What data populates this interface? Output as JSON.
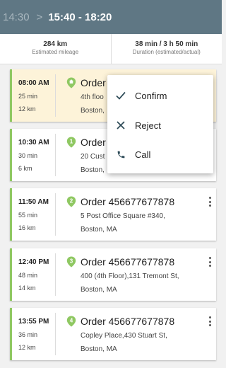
{
  "header": {
    "prev_range": "14:30",
    "separator": ">",
    "current_range": "15:40 - 18:20"
  },
  "stats": {
    "mileage_value": "284 km",
    "mileage_label": "Estimated mileage",
    "duration_value": "38 min / 3 h 50 min",
    "duration_label": "Duration (estimated/actual)"
  },
  "colors": {
    "header_bg": "#5f7784",
    "accent_green": "#8fc862",
    "selected_bg": "#fdf3d9"
  },
  "orders": [
    {
      "time": "08:00 AM",
      "duration": "25 min",
      "distance": "12 km",
      "title": "Order '",
      "addr1": "4th floo",
      "addr2": "Boston,",
      "number": "",
      "icon": "home-pin-icon"
    },
    {
      "time": "10:30 AM",
      "duration": "30 min",
      "distance": "6 km",
      "title": "Order 4",
      "addr1": "20 Cust",
      "addr2": "Boston,",
      "number": "1",
      "icon": "numbered-pin-icon"
    },
    {
      "time": "11:50 AM",
      "duration": "55 min",
      "distance": "16 km",
      "title": "Order 456677677878",
      "addr1": "5 Post Office Square #340,",
      "addr2": "Boston, MA",
      "number": "2",
      "icon": "numbered-pin-icon"
    },
    {
      "time": "12:40 PM",
      "duration": "48 min",
      "distance": "14 km",
      "title": "Order 456677677878",
      "addr1": "400 (4th Floor),131 Tremont St,",
      "addr2": "Boston, MA",
      "number": "3",
      "icon": "numbered-pin-icon"
    },
    {
      "time": "13:55 PM",
      "duration": "36 min",
      "distance": "12 km",
      "title": "Order 456677677878",
      "addr1": "Copley Place,430 Stuart St,",
      "addr2": "Boston, MA",
      "number": "4",
      "icon": "numbered-pin-icon"
    }
  ],
  "menu": {
    "confirm": "Confirm",
    "reject": "Reject",
    "call": "Call"
  }
}
